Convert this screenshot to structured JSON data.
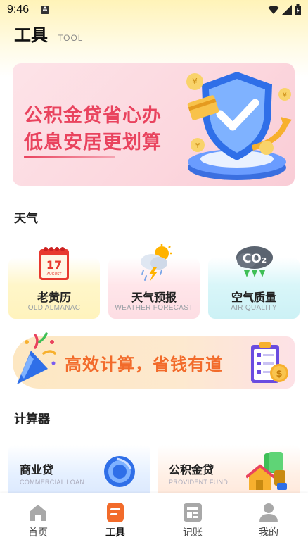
{
  "status_bar": {
    "time": "9:46",
    "notification_glyph": "A"
  },
  "header": {
    "title": "工具",
    "subtitle": "TOOL"
  },
  "promo_banner": {
    "line1": "公积金贷省心办",
    "line2": "低息安居更划算"
  },
  "weather_section": {
    "title": "天气",
    "cards": [
      {
        "label": "老黄历",
        "sub": "OLD ALMANAC",
        "icon": "calendar-icon",
        "calendar_day": "17",
        "calendar_month": "AUGUST"
      },
      {
        "label": "天气预报",
        "sub": "WEATHER FORECAST",
        "icon": "weather-storm-icon"
      },
      {
        "label": "空气质量",
        "sub": "AIR QUALITY",
        "icon": "co2-cloud-icon",
        "co2": "CO₂"
      }
    ]
  },
  "savings_banner": {
    "text": "高效计算，省钱有道"
  },
  "calculator_section": {
    "title": "计算器",
    "cards": [
      {
        "label": "商业贷",
        "sub": "COMMERCIAL LOAN",
        "icon": "coin-icon"
      },
      {
        "label": "公积金贷",
        "sub": "PROVIDENT FUND",
        "icon": "house-money-icon"
      }
    ]
  },
  "bottom_nav": {
    "items": [
      {
        "label": "首页",
        "icon": "home-icon"
      },
      {
        "label": "工具",
        "icon": "tool-icon",
        "active": true
      },
      {
        "label": "记账",
        "icon": "ledger-icon"
      },
      {
        "label": "我的",
        "icon": "user-icon"
      }
    ]
  },
  "colors": {
    "accent": "#f26b2b",
    "banner_red": "#e9435e",
    "nav_grey": "#a8a8a8"
  }
}
